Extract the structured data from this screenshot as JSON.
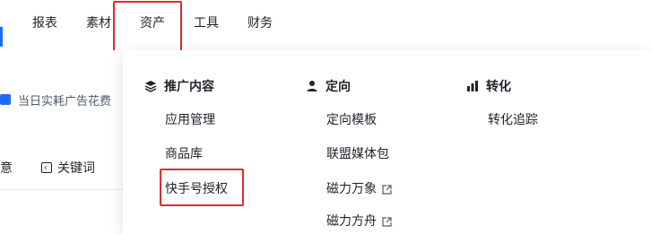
{
  "nav": {
    "items": [
      "报表",
      "素材",
      "资产",
      "工具",
      "财务"
    ]
  },
  "content": {
    "spend_label": "当日实耗广告花费",
    "tab_partial": "意",
    "keyword_tab": "关键词"
  },
  "dropdown": {
    "columns": [
      {
        "title": "推广内容",
        "icon": "layers-icon",
        "items": [
          "应用管理",
          "商品库",
          "快手号授权"
        ]
      },
      {
        "title": "定向",
        "icon": "person-icon",
        "items": [
          "定向模板",
          "联盟媒体包",
          "磁力万象",
          "磁力方舟"
        ]
      },
      {
        "title": "转化",
        "icon": "bar-chart-icon",
        "items": [
          "转化追踪"
        ]
      }
    ]
  },
  "colors": {
    "accent": "#1f6bff",
    "highlight": "#e22b2b"
  }
}
